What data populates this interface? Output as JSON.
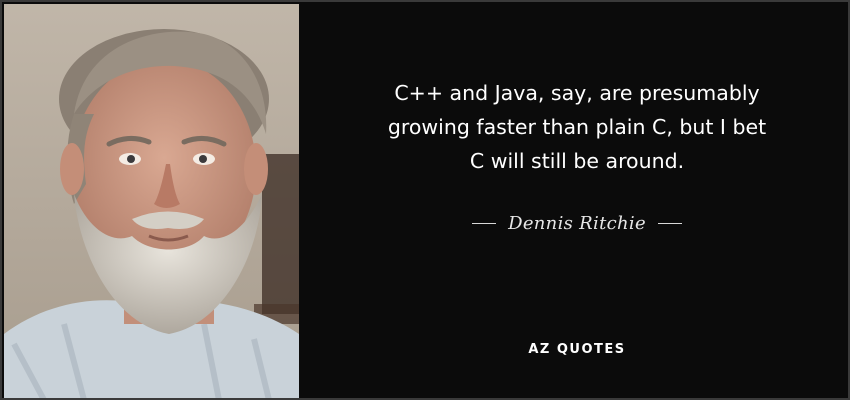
{
  "quote": {
    "text": "C++ and Java, say, are presumably\ngrowing faster than plain C, but I bet\nC will still be around.",
    "author": "Dennis Ritchie"
  },
  "brand": {
    "name": "AZ QUOTES"
  },
  "portrait": {
    "icon": "portrait-photo"
  },
  "colors": {
    "background": "#0b0b0b",
    "text": "#ffffff",
    "border": "#3a3a3a"
  }
}
